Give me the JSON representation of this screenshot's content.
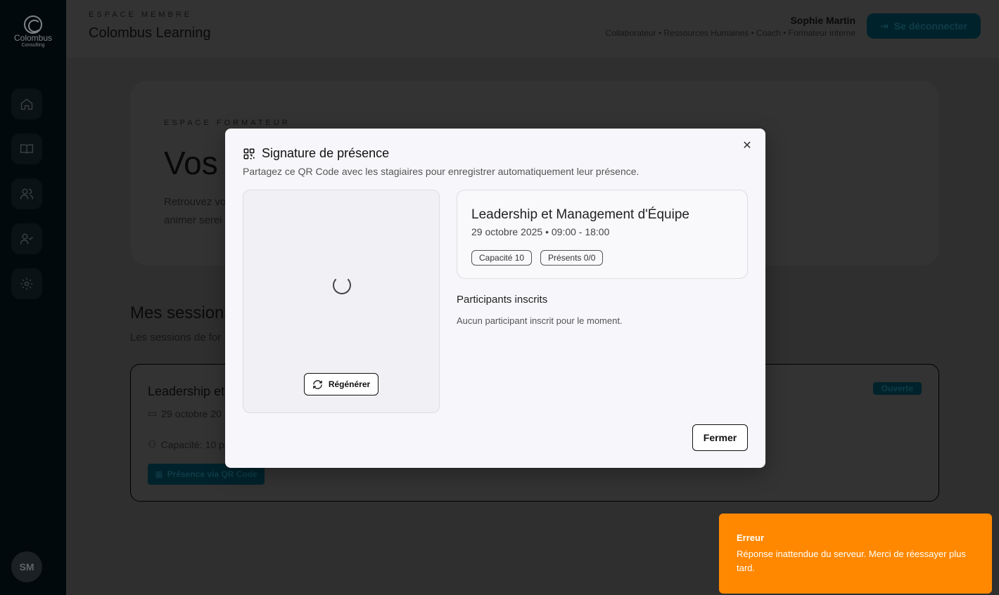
{
  "sidebar": {
    "logo_name": "Colombus",
    "logo_sub": "Consulting",
    "nav": [
      "home-icon",
      "book-icon",
      "users-icon",
      "user-check-icon",
      "gear-icon"
    ],
    "avatar": "SM"
  },
  "header": {
    "eyebrow": "ESPACE MEMBRE",
    "title": "Colombus Learning",
    "user_name": "Sophie Martin",
    "user_roles": "Collaborateur • Ressources Humaines • Coach • Formateur interne",
    "logout_label": "Se déconnecter"
  },
  "hero": {
    "eyebrow": "ESPACE FORMATEUR",
    "title": "Vos",
    "line1": "Retrouvez vo",
    "line2": "animer serei"
  },
  "sessions": {
    "title": "Mes sessions",
    "subtitle": "Les sessions de for",
    "card": {
      "title": "Leadership et M",
      "date": "29 octobre 20",
      "capacity": "Capacité: 10 pa",
      "qr_button": "Présence via QR Code",
      "badge": "Ouverte"
    }
  },
  "modal": {
    "title": "Signature de présence",
    "description": "Partagez ce QR Code avec les stagiaires pour enregistrer automatiquement leur présence.",
    "regenerate_label": "Régénérer",
    "session_title": "Leadership et Management d'Équipe",
    "session_datetime": "29 octobre 2025 • 09:00 - 18:00",
    "capacity_tag": "Capacité 10",
    "present_tag": "Présents 0/0",
    "participants_heading": "Participants inscrits",
    "participants_empty": "Aucun participant inscrit pour le moment.",
    "close_label": "Fermer"
  },
  "toast": {
    "title": "Erreur",
    "message": "Réponse inattendue du serveur. Merci de réessayer plus tard.",
    "color": "#ff8800"
  },
  "colors": {
    "accent": "#00a9d6",
    "sidebar": "#003c5a"
  }
}
